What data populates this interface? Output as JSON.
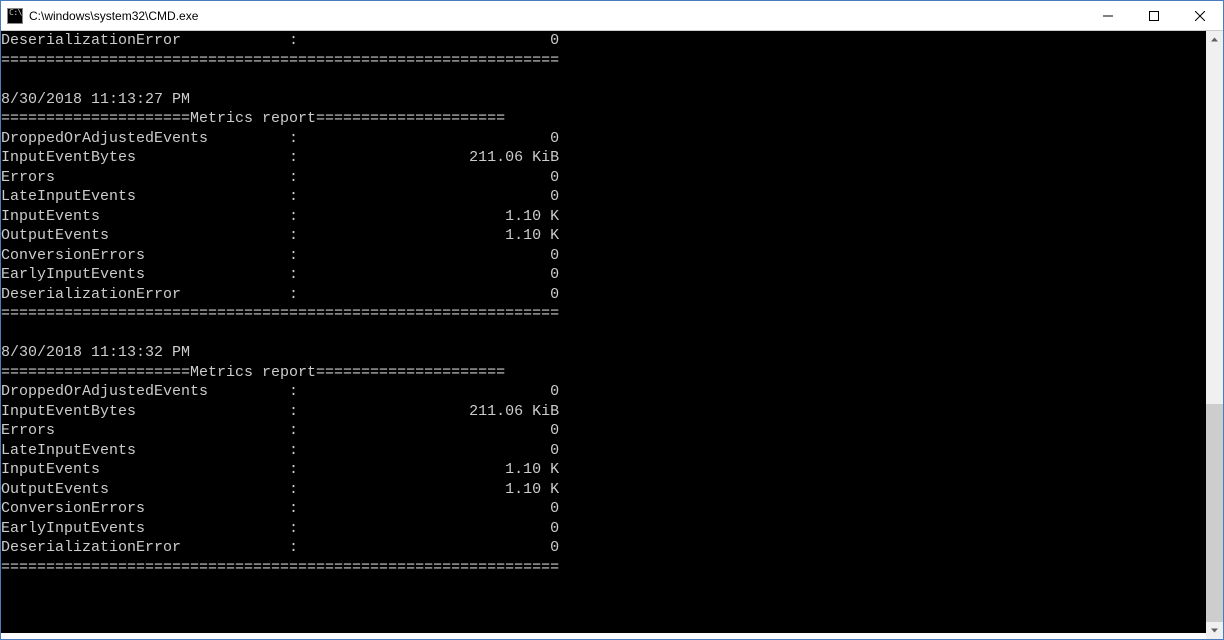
{
  "window": {
    "title": "C:\\windows\\system32\\CMD.exe"
  },
  "terminal": {
    "report_header_label": "Metrics report",
    "top_partial": {
      "metrics": [
        {
          "name": "DeserializationError",
          "value": "0"
        }
      ]
    },
    "reports": [
      {
        "timestamp": "8/30/2018 11:13:27 PM",
        "metrics": [
          {
            "name": "DroppedOrAdjustedEvents",
            "value": "0"
          },
          {
            "name": "InputEventBytes",
            "value": "211.06 KiB"
          },
          {
            "name": "Errors",
            "value": "0"
          },
          {
            "name": "LateInputEvents",
            "value": "0"
          },
          {
            "name": "InputEvents",
            "value": "1.10 K"
          },
          {
            "name": "OutputEvents",
            "value": "1.10 K"
          },
          {
            "name": "ConversionErrors",
            "value": "0"
          },
          {
            "name": "EarlyInputEvents",
            "value": "0"
          },
          {
            "name": "DeserializationError",
            "value": "0"
          }
        ]
      },
      {
        "timestamp": "8/30/2018 11:13:32 PM",
        "metrics": [
          {
            "name": "DroppedOrAdjustedEvents",
            "value": "0"
          },
          {
            "name": "InputEventBytes",
            "value": "211.06 KiB"
          },
          {
            "name": "Errors",
            "value": "0"
          },
          {
            "name": "LateInputEvents",
            "value": "0"
          },
          {
            "name": "InputEvents",
            "value": "1.10 K"
          },
          {
            "name": "OutputEvents",
            "value": "1.10 K"
          },
          {
            "name": "ConversionErrors",
            "value": "0"
          },
          {
            "name": "EarlyInputEvents",
            "value": "0"
          },
          {
            "name": "DeserializationError",
            "value": "0"
          }
        ]
      }
    ]
  },
  "layout": {
    "total_width": 62,
    "name_width": 32,
    "value_width": 29,
    "header_left_eq": 21,
    "header_right_eq": 21
  },
  "scrollbar": {
    "thumb_top_pct": 62,
    "thumb_height_pct": 38
  }
}
